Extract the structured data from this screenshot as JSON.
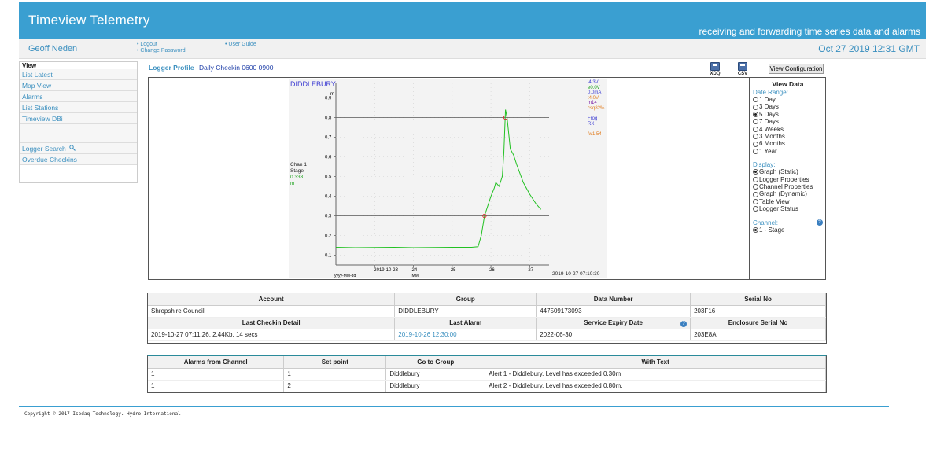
{
  "header": {
    "title": "Timeview Telemetry",
    "tagline": "receiving and forwarding time series data and alarms"
  },
  "userbar": {
    "user": "Geoff Neden",
    "logout": "• Logout",
    "change_password": "• Change Password",
    "user_guide": "• User Guide",
    "datetime": "Oct 27 2019 12:31 GMT"
  },
  "sidebar": {
    "header": "View",
    "items": [
      "List Latest",
      "Map View",
      "Alarms",
      "List Stations",
      "Timeview DBi",
      "Logger Search",
      "Overdue Checkins"
    ]
  },
  "profile": {
    "label": "Logger Profile",
    "value": "Daily Checkin 0600 0900"
  },
  "toolbar": {
    "xdq_label": "XDQ",
    "csv_label": "CSV",
    "view_config": "View Configuration"
  },
  "chart_data": {
    "type": "line",
    "title": "DIDDLEBURY",
    "ylabel": "m",
    "ylim": [
      0.05,
      0.95
    ],
    "yticks": [
      "0.1",
      "0.2",
      "0.3",
      "0.4",
      "0.5",
      "0.6",
      "0.7",
      "0.8",
      "0.9"
    ],
    "xticks": [
      "2019-10-23",
      "24",
      "25",
      "26",
      "27"
    ],
    "xtick_sub": [
      "yyyy-MM-dd",
      "MM"
    ],
    "xlim": [
      "2019-10-22",
      "2019-10-27T12:00"
    ],
    "thresholds": [
      0.3,
      0.8
    ],
    "series": [
      {
        "color": "#22c122",
        "x": [
          "2019-10-22T00:00",
          "2019-10-22T12:00",
          "2019-10-23T00:00",
          "2019-10-23T12:00",
          "2019-10-24T00:00",
          "2019-10-24T12:00",
          "2019-10-25T00:00",
          "2019-10-25T06:00",
          "2019-10-25T12:00",
          "2019-10-25T16:00",
          "2019-10-25T18:00",
          "2019-10-25T20:00",
          "2019-10-26T00:00",
          "2019-10-26T02:00",
          "2019-10-26T03:00",
          "2019-10-26T05:00",
          "2019-10-26T07:00",
          "2019-10-26T08:00",
          "2019-10-26T09:00",
          "2019-10-26T10:00",
          "2019-10-26T12:00",
          "2019-10-26T14:00",
          "2019-10-26T16:00",
          "2019-10-26T20:00",
          "2019-10-27T00:00",
          "2019-10-27T04:00",
          "2019-10-27T07:00"
        ],
        "y": [
          0.14,
          0.138,
          0.139,
          0.14,
          0.138,
          0.139,
          0.14,
          0.14,
          0.14,
          0.143,
          0.2,
          0.3,
          0.4,
          0.44,
          0.47,
          0.45,
          0.5,
          0.62,
          0.84,
          0.8,
          0.64,
          0.61,
          0.56,
          0.47,
          0.41,
          0.36,
          0.333
        ]
      }
    ],
    "alarm_points": [
      {
        "x": "2019-10-25T20:00",
        "y": 0.3
      },
      {
        "x": "2019-10-26T09:00",
        "y": 0.8
      }
    ],
    "channel_label": "Chan 1",
    "stage_label": "Stage",
    "current_value": "0.333",
    "current_unit": "m",
    "timestamp": "2019-10-27 07:10:30",
    "legend": [
      {
        "text": "i4.3V",
        "color": "#3a3ad1"
      },
      {
        "text": "e0.0V",
        "color": "#1aa11a"
      },
      {
        "text": "0.0mA",
        "color": "#3a3ad1"
      },
      {
        "text": "t4.0V",
        "color": "#e07a1a"
      },
      {
        "text": "m14",
        "color": "#7a1aa1"
      },
      {
        "text": "csq82%",
        "color": "#e07a1a"
      },
      {
        "text": "",
        "color": "#000"
      },
      {
        "text": "Frog",
        "color": "#3a3ad1"
      },
      {
        "text": "RX",
        "color": "#3a3ad1"
      },
      {
        "text": "",
        "color": "#000"
      },
      {
        "text": "fw1.54",
        "color": "#e07a1a"
      }
    ]
  },
  "view_data": {
    "title": "View Data",
    "date_range_label": "Date Range:",
    "date_ranges": [
      "1 Day",
      "3 Days",
      "5 Days",
      "7 Days",
      "4 Weeks",
      "3 Months",
      "6 Months",
      "1 Year"
    ],
    "date_selected": "5 Days",
    "display_label": "Display:",
    "displays": [
      "Graph (Static)",
      "Logger Properties",
      "Channel Properties",
      "Graph (Dynamic)",
      "Table View",
      "Logger Status"
    ],
    "display_selected": "Graph (Static)",
    "channel_label": "Channel:",
    "channels": [
      "1 - Stage"
    ],
    "channel_selected": "1 - Stage"
  },
  "account_table": {
    "headers1": [
      "Account",
      "Group",
      "Data Number",
      "Serial No"
    ],
    "row1": [
      "Shropshire Council",
      "DIDDLEBURY",
      "447509173093",
      "203F16"
    ],
    "headers2": [
      "Last Checkin Detail",
      "Last Alarm",
      "Service Expiry Date",
      "Enclosure Serial No"
    ],
    "row2": [
      "2019-10-27 07:11:26, 2.44Kb, 14 secs",
      "2019-10-26 12:30:00",
      "2022-06-30",
      "203E8A"
    ]
  },
  "alarms_table": {
    "headers": [
      "Alarms from Channel",
      "Set point",
      "Go to Group",
      "With Text"
    ],
    "rows": [
      [
        "1",
        "1",
        "Diddlebury",
        "Alert 1 - Diddlebury. Level has exceeded 0.30m"
      ],
      [
        "1",
        "2",
        "Diddlebury",
        "Alert 2 - Diddlebury. Level has exceeded 0.80m."
      ]
    ]
  },
  "footer": {
    "copyright": "Copyright © 2017 Isodaq Technology. Hydro International"
  }
}
